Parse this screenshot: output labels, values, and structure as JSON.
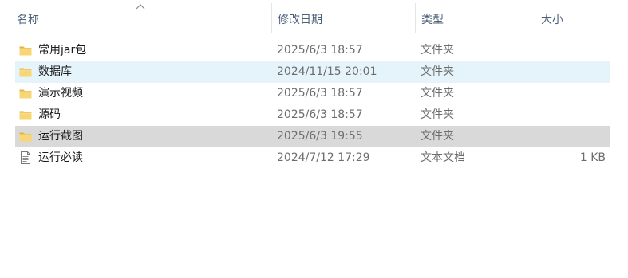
{
  "header": {
    "columns": {
      "name": "名称",
      "date": "修改日期",
      "type": "类型",
      "size": "大小"
    },
    "sort_indicator": "chevron-up-icon"
  },
  "files": [
    {
      "name": "常用jar包",
      "date": "2025/6/3 18:57",
      "type": "文件夹",
      "size": "",
      "icon": "folder-icon",
      "state": "normal"
    },
    {
      "name": "数据库",
      "date": "2024/11/15 20:01",
      "type": "文件夹",
      "size": "",
      "icon": "folder-icon",
      "state": "hovered"
    },
    {
      "name": "演示视频",
      "date": "2025/6/3 18:57",
      "type": "文件夹",
      "size": "",
      "icon": "folder-icon",
      "state": "normal"
    },
    {
      "name": "源码",
      "date": "2025/6/3 18:57",
      "type": "文件夹",
      "size": "",
      "icon": "folder-icon",
      "state": "normal"
    },
    {
      "name": "运行截图",
      "date": "2025/6/3 19:55",
      "type": "文件夹",
      "size": "",
      "icon": "folder-icon",
      "state": "selected"
    },
    {
      "name": "运行必读",
      "date": "2024/7/12 17:29",
      "type": "文本文档",
      "size": "1 KB",
      "icon": "text-file-icon",
      "state": "normal"
    }
  ],
  "colors": {
    "hover_bg": "#e5f3fb",
    "selected_bg": "#d9d9d9",
    "header_text": "#4c607a",
    "folder_yellow": "#f8d675"
  }
}
